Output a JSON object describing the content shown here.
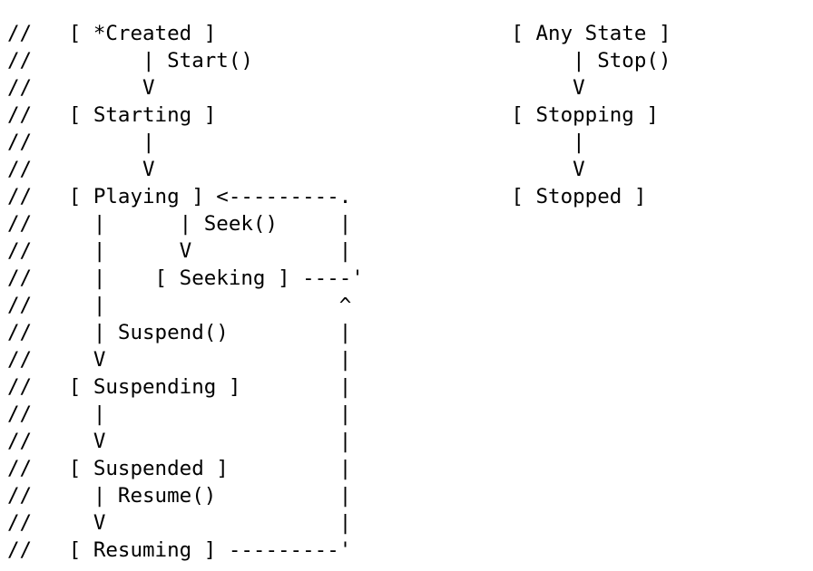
{
  "diagram": {
    "lines": [
      "//   [ *Created ]                        [ Any State ]",
      "//         | Start()                          | Stop()",
      "//         V                                  V",
      "//   [ Starting ]                        [ Stopping ]",
      "//         |                                  |",
      "//         V                                  V",
      "//   [ Playing ] <---------.             [ Stopped ]",
      "//     |      | Seek()     |",
      "//     |      V            |",
      "//     |    [ Seeking ] ----'",
      "//     |                   ^",
      "//     | Suspend()         |",
      "//     V                   |",
      "//   [ Suspending ]        |",
      "//     |                   |",
      "//     V                   |",
      "//   [ Suspended ]         |",
      "//     | Resume()          |",
      "//     V                   |",
      "//   [ Resuming ] ---------'"
    ]
  }
}
